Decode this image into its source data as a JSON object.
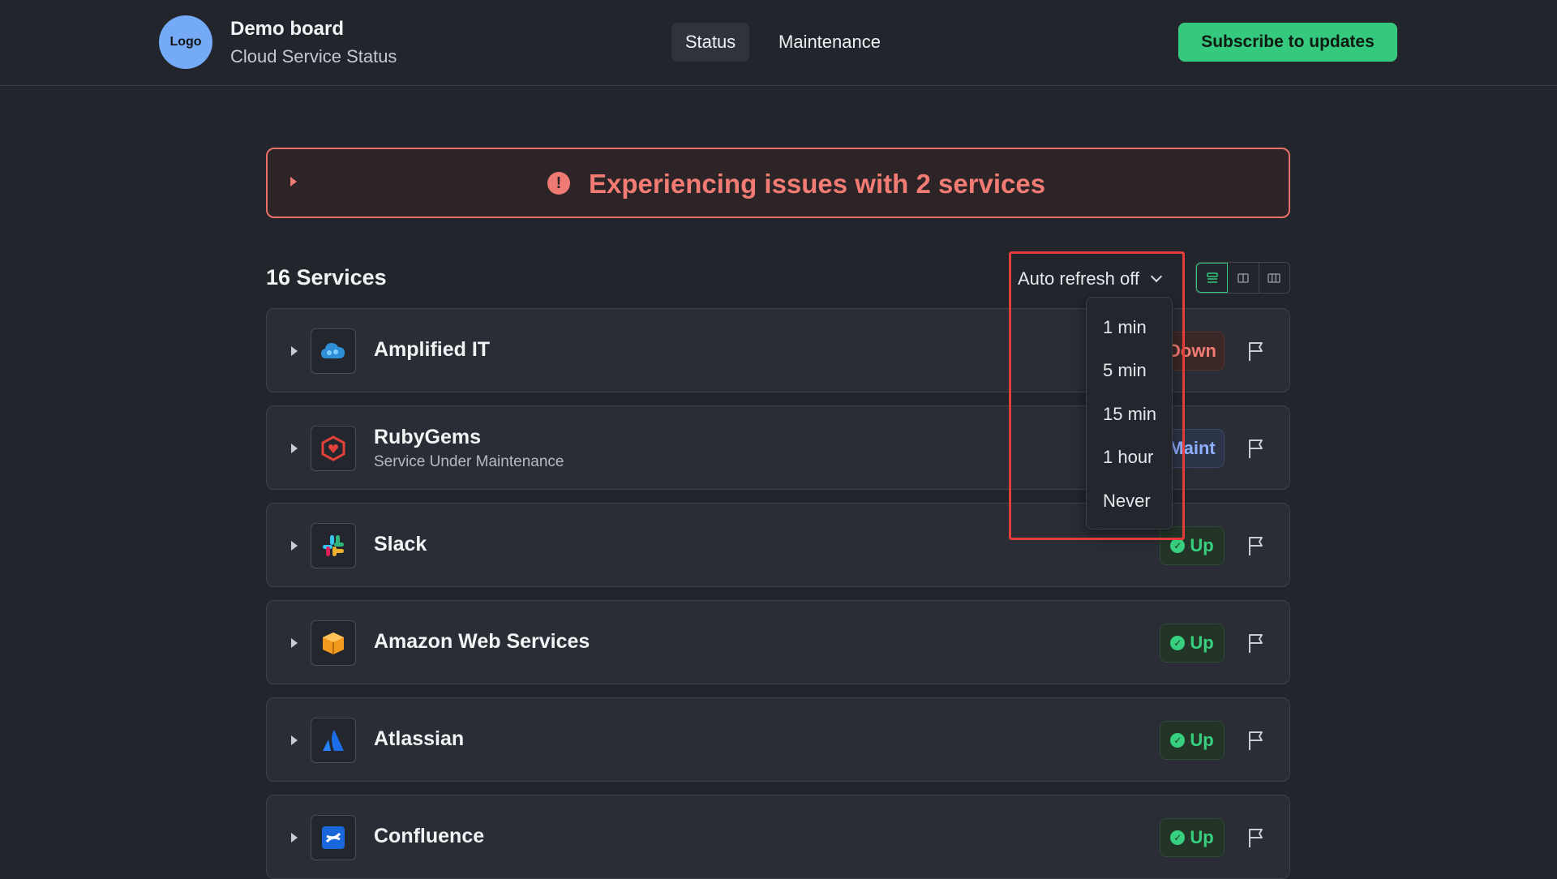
{
  "header": {
    "logo_text": "Logo",
    "title": "Demo board",
    "subtitle": "Cloud Service Status",
    "nav": [
      {
        "label": "Status",
        "active": true
      },
      {
        "label": "Maintenance",
        "active": false
      }
    ],
    "subscribe_label": "Subscribe to updates"
  },
  "alert": {
    "icon": "exclamation-circle-icon",
    "message": "Experiencing issues with 2 services",
    "color": "#f27c74"
  },
  "services_header": {
    "count_label": "16 Services",
    "refresh_label": "Auto refresh off",
    "view_modes": [
      "list-view-icon",
      "two-column-icon",
      "three-column-icon"
    ]
  },
  "refresh_menu": {
    "options": [
      "1 min",
      "5 min",
      "15 min",
      "1 hour",
      "Never"
    ]
  },
  "services": [
    {
      "name": "Amplified IT",
      "subtitle": "",
      "status": "Down",
      "logo": "cloud-icon"
    },
    {
      "name": "RubyGems",
      "subtitle": "Service Under Maintenance",
      "status": "Maint",
      "logo": "ruby-icon"
    },
    {
      "name": "Slack",
      "subtitle": "",
      "status": "Up",
      "logo": "slack-icon"
    },
    {
      "name": "Amazon Web Services",
      "subtitle": "",
      "status": "Up",
      "logo": "aws-box-icon"
    },
    {
      "name": "Atlassian",
      "subtitle": "",
      "status": "Up",
      "logo": "atlassian-icon"
    },
    {
      "name": "Confluence",
      "subtitle": "",
      "status": "Up",
      "logo": "confluence-icon"
    }
  ],
  "colors": {
    "background": "#22252c",
    "accent_green": "#34c97d",
    "down_red": "#f27c74",
    "maint_blue": "#8fb0ff"
  }
}
